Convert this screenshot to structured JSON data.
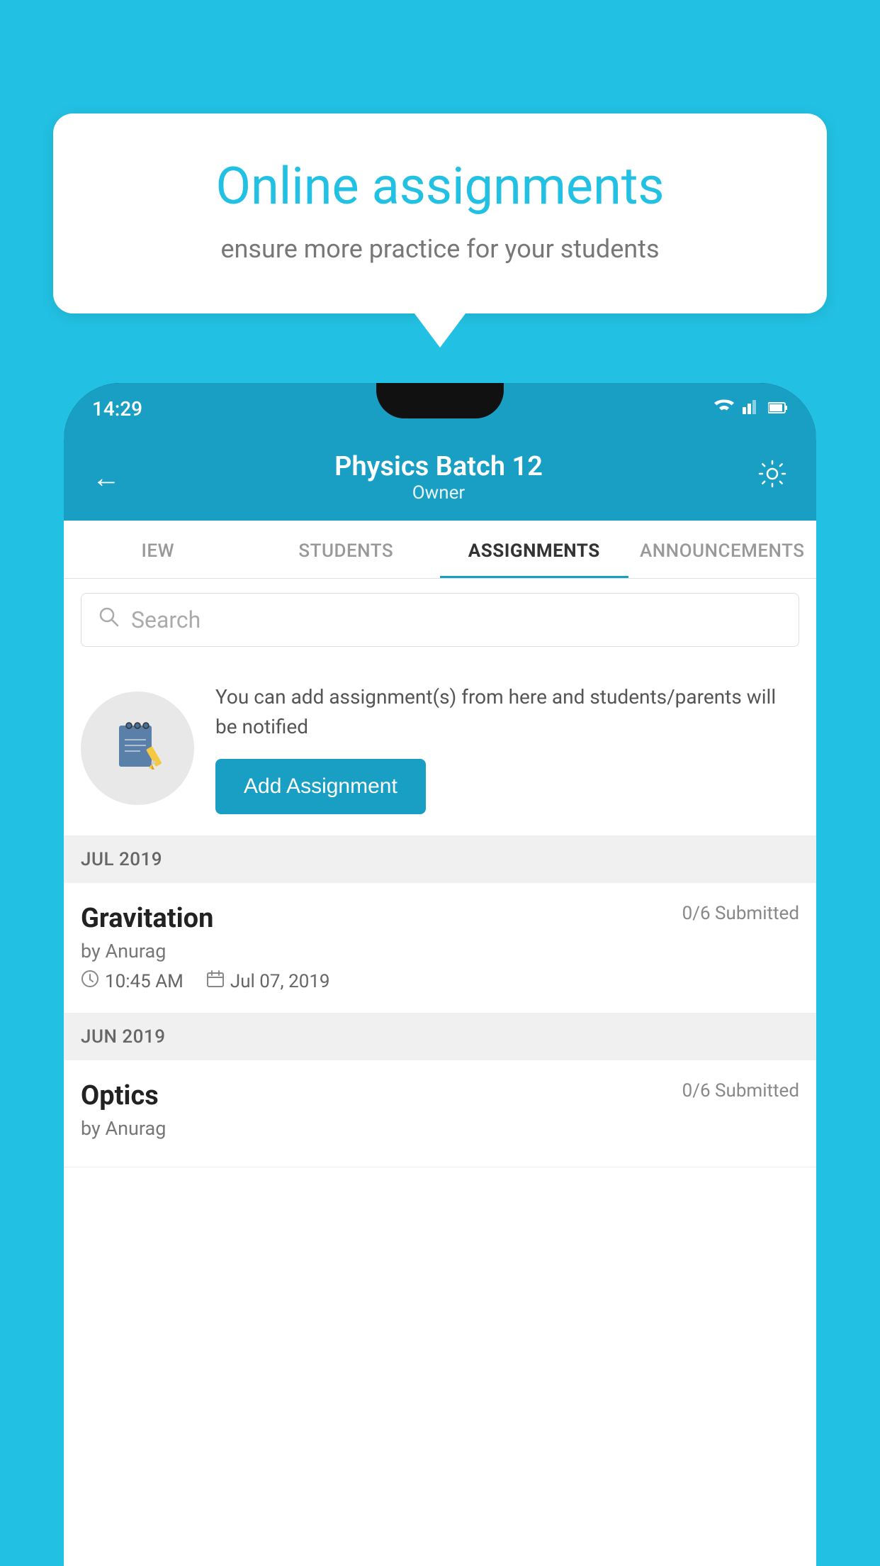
{
  "background_color": "#22c1e3",
  "speech_bubble": {
    "title": "Online assignments",
    "subtitle": "ensure more practice for your students"
  },
  "status_bar": {
    "time": "14:29",
    "icons": [
      "wifi",
      "signal",
      "battery"
    ]
  },
  "header": {
    "title": "Physics Batch 12",
    "subtitle": "Owner",
    "back_label": "←",
    "settings_label": "⚙"
  },
  "tabs": [
    {
      "label": "IEW",
      "active": false
    },
    {
      "label": "STUDENTS",
      "active": false
    },
    {
      "label": "ASSIGNMENTS",
      "active": true
    },
    {
      "label": "ANNOUNCEMENTS",
      "active": false
    }
  ],
  "search": {
    "placeholder": "Search"
  },
  "promo": {
    "text": "You can add assignment(s) from here and students/parents will be notified",
    "button_label": "Add Assignment"
  },
  "sections": [
    {
      "header": "JUL 2019",
      "assignments": [
        {
          "title": "Gravitation",
          "submitted": "0/6 Submitted",
          "author": "by Anurag",
          "time": "10:45 AM",
          "date": "Jul 07, 2019"
        }
      ]
    },
    {
      "header": "JUN 2019",
      "assignments": [
        {
          "title": "Optics",
          "submitted": "0/6 Submitted",
          "author": "by Anurag",
          "time": "",
          "date": ""
        }
      ]
    }
  ],
  "icons": {
    "back": "←",
    "settings": "⚙",
    "search": "🔍",
    "clock": "🕐",
    "calendar": "📅"
  }
}
